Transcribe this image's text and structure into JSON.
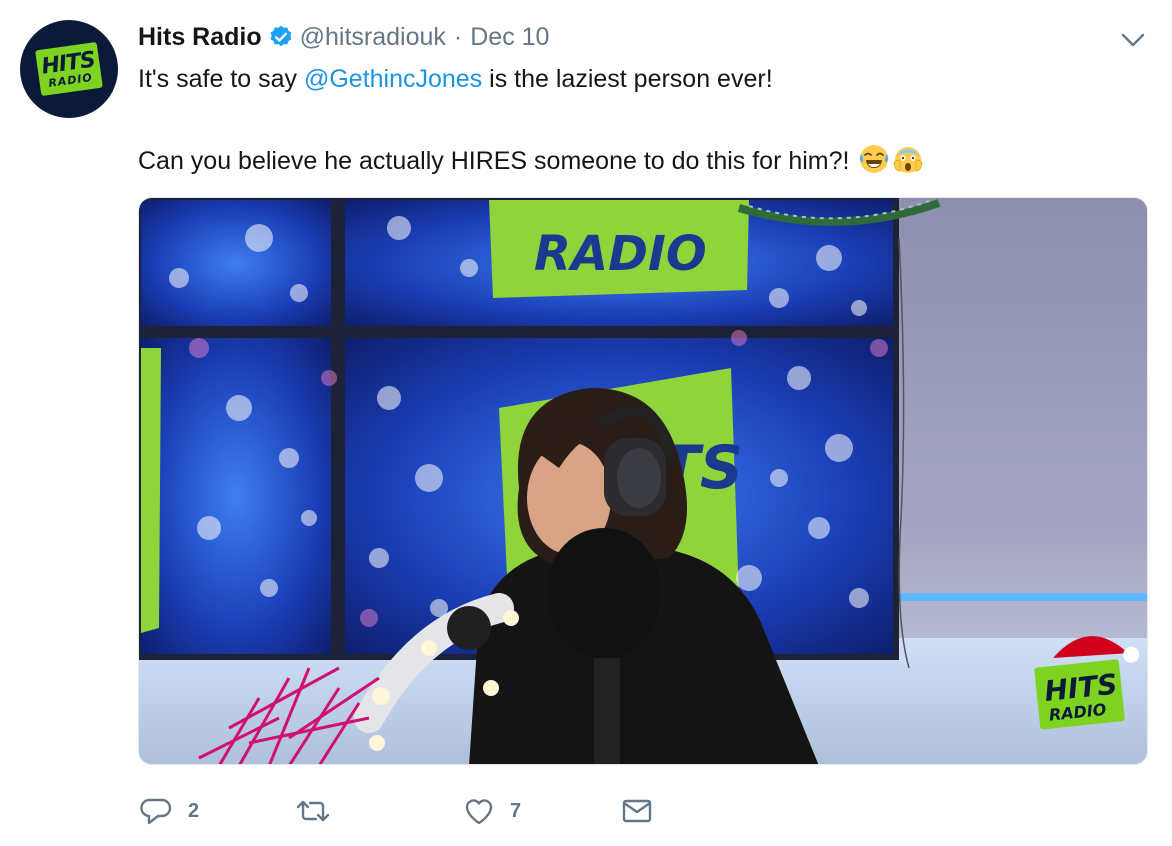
{
  "tweet": {
    "author": {
      "name": "Hits Radio",
      "handle": "@hitsradiouk",
      "verified": true,
      "avatar_logo_top": "HITS",
      "avatar_logo_bottom": "RADIO"
    },
    "separator": "·",
    "date": "Dec 10",
    "text": {
      "line1_before": "It's safe to say ",
      "mention": "@GethincJones",
      "line1_after": " is the laziest person ever!",
      "line2": "Can you believe he actually HIRES someone to do this for him?! "
    },
    "emojis": [
      "face-with-tears-of-joy-icon",
      "face-screaming-in-fear-icon"
    ],
    "media": {
      "type": "video-thumbnail",
      "screen_text_top": "RADIO",
      "screen_text_center": "TS",
      "corner_logo_top": "HITS",
      "corner_logo_bottom": "RADIO"
    },
    "actions": {
      "reply_count": "2",
      "retweet_count": "",
      "like_count": "7"
    }
  },
  "colors": {
    "link": "#1b95e0",
    "secondary_text": "#657786",
    "brand_green": "#7ed321",
    "brand_navy": "#0c1a3a",
    "verified": "#1da1f2"
  }
}
